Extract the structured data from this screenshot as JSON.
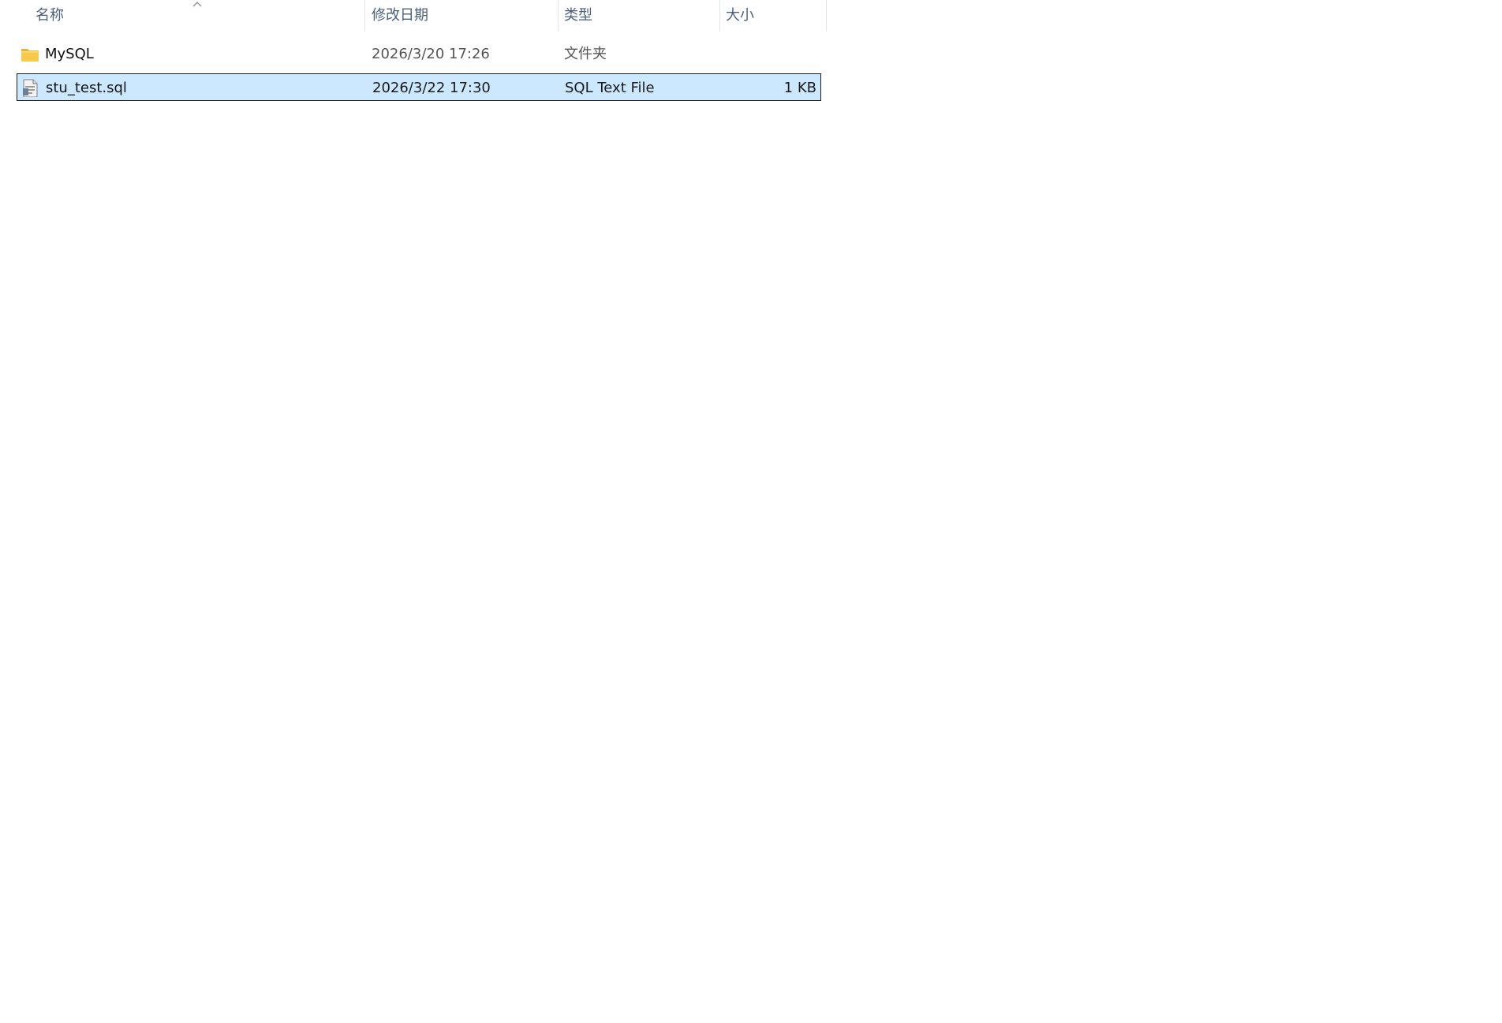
{
  "header": {
    "columns": {
      "name": "名称",
      "date": "修改日期",
      "type": "类型",
      "size": "大小"
    },
    "sort": "ascending"
  },
  "files": [
    {
      "name": "MySQL",
      "date": "2026/3/20 17:26",
      "type": "文件夹",
      "size": "",
      "icon": "folder-icon",
      "selected": false
    },
    {
      "name": "stu_test.sql",
      "date": "2026/3/22 17:30",
      "type": "SQL Text File",
      "size": "1 KB",
      "icon": "sql-file-icon",
      "selected": true
    }
  ],
  "colors": {
    "selection_fill": "#cce8ff",
    "selection_border": "#1b1b1b",
    "header_text": "#4c607a",
    "folder_yellow": "#f8c94a"
  }
}
